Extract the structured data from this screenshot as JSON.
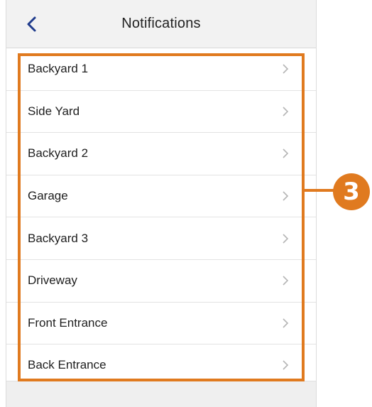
{
  "header": {
    "title": "Notifications",
    "back_icon": "chevron-left-icon"
  },
  "list": {
    "items": [
      {
        "label": "Backyard 1"
      },
      {
        "label": "Side Yard"
      },
      {
        "label": "Backyard 2"
      },
      {
        "label": "Garage"
      },
      {
        "label": "Backyard 3"
      },
      {
        "label": "Driveway"
      },
      {
        "label": "Front Entrance"
      },
      {
        "label": "Back Entrance"
      }
    ],
    "chevron_icon": "chevron-right-icon"
  },
  "callout": {
    "number": "3",
    "color": "#e07a1f"
  },
  "colors": {
    "accent": "#1f3b8c",
    "callout": "#e07a1f"
  }
}
